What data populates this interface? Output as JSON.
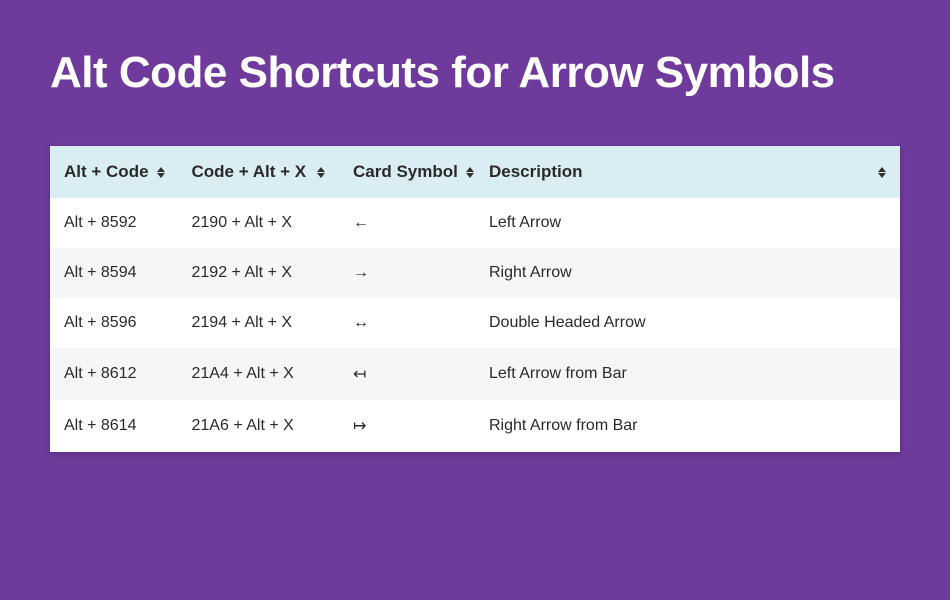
{
  "title": "Alt Code Shortcuts for Arrow Symbols",
  "columns": {
    "alt_code": "Alt + Code",
    "code_alt_x": "Code + Alt + X",
    "symbol": "Card Symbol",
    "description": "Description"
  },
  "rows": [
    {
      "alt_code": "Alt + 8592",
      "code_alt_x": "2190 + Alt + X",
      "symbol": "←",
      "description": "Left Arrow"
    },
    {
      "alt_code": "Alt + 8594",
      "code_alt_x": "2192 + Alt + X",
      "symbol": "→",
      "description": "Right Arrow"
    },
    {
      "alt_code": "Alt + 8596",
      "code_alt_x": "2194 + Alt + X",
      "symbol": "↔",
      "description": "Double Headed Arrow"
    },
    {
      "alt_code": "Alt + 8612",
      "code_alt_x": "21A4 + Alt + X",
      "symbol": "↤",
      "description": "Left Arrow from Bar"
    },
    {
      "alt_code": "Alt + 8614",
      "code_alt_x": "21A6 + Alt + X",
      "symbol": "↦",
      "description": "Right Arrow from Bar"
    }
  ]
}
